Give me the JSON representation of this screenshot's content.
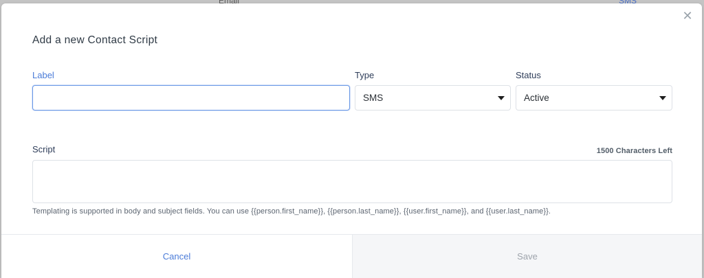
{
  "background": {
    "column_left": "Email",
    "column_right": "SMS"
  },
  "modal": {
    "title": "Add a new Contact Script",
    "close_icon": "close-icon"
  },
  "form": {
    "label": {
      "label": "Label",
      "value": "",
      "placeholder": ""
    },
    "type": {
      "label": "Type",
      "value": "SMS"
    },
    "status": {
      "label": "Status",
      "value": "Active"
    },
    "script": {
      "label": "Script",
      "chars_left": "1500 Characters Left",
      "value": "",
      "help": "Templating is supported in body and subject fields. You can use {{person.first_name}}, {{person.last_name}}, {{user.first_name}}, and {{user.last_name}}."
    }
  },
  "footer": {
    "cancel_label": "Cancel",
    "save_label": "Save"
  },
  "colors": {
    "accent": "#4a7bd8",
    "disabled_text": "#9da3ab"
  }
}
